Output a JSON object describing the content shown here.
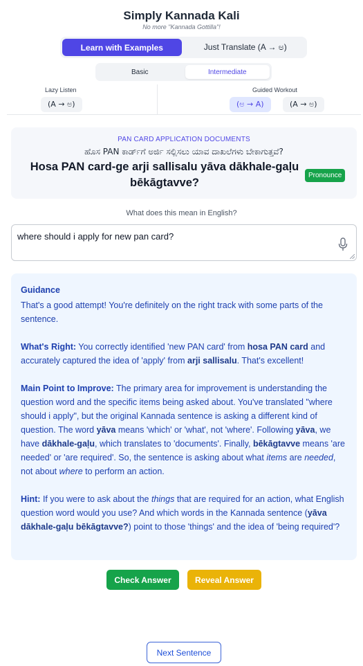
{
  "app": {
    "title": "Simply Kannada Kali",
    "tagline": "No more \"Kannada Gottilla\"!"
  },
  "modes": {
    "learn_label": "Learn with Examples",
    "translate_label": "Just Translate (A → ಅ)",
    "active": "learn"
  },
  "levels": {
    "basic_label": "Basic",
    "intermediate_label": "Intermediate",
    "active": "intermediate"
  },
  "practice": {
    "lazy_listen_label": "Lazy Listen",
    "lazy_listen_btn": "(A → ಅ)",
    "guided_workout_label": "Guided Workout",
    "guided_btn_1": "(ಅ → A)",
    "guided_btn_2": "(A → ಅ)"
  },
  "sentence": {
    "category": "PAN CARD APPLICATION DOCUMENTS",
    "kannada": "ಹೊಸ PAN ಕಾರ್ಡ್‌ಗೆ ಅರ್ಜಿ ಸಲ್ಲಿಸಲು ಯಾವ ದಾಖಲೆಗಳು ಬೇಕಾಗುತ್ತವೆ?",
    "transliteration": "Hosa PAN card-ge arji sallisalu yāva dākhale-gaḷu bēkāgtavve?",
    "pronounce_label": "Pronounce"
  },
  "prompt": {
    "question": "What does this mean in English?",
    "answer_value": "where should i apply for new pan card?"
  },
  "guidance": {
    "title": "Guidance",
    "intro": "That's a good attempt! You're definitely on the right track with some parts of the sentence.",
    "whats_right_label": "What's Right:",
    "right_1": " You correctly identified 'new PAN card' from ",
    "right_b1": "hosa PAN card",
    "right_2": " and accurately captured the idea of 'apply' from ",
    "right_b2": "arji sallisalu",
    "right_3": ". That's excellent!",
    "improve_label": "Main Point to Improve:",
    "imp_1": " The primary area for improvement is understanding the question word and the specific items being asked about. You've translated \"where should i apply\", but the original Kannada sentence is asking a different kind of question. The word ",
    "imp_b1": "yāva",
    "imp_2": " means 'which' or 'what', not 'where'. Following ",
    "imp_b2": "yāva",
    "imp_3": ", we have ",
    "imp_b3": "dākhale-gaḷu",
    "imp_4": ", which translates to 'documents'. Finally, ",
    "imp_b4": "bēkāgtavve",
    "imp_5": " means 'are needed' or 'are required'. So, the sentence is asking about what ",
    "imp_i1": "items",
    "imp_6": " are ",
    "imp_i2": "needed",
    "imp_7": ", not about ",
    "imp_i3": "where",
    "imp_8": " to perform an action.",
    "hint_label": "Hint:",
    "hint_1": " If you were to ask about the ",
    "hint_i1": "things",
    "hint_2": " that are required for an action, what English question word would you use? And which words in the Kannada sentence (",
    "hint_b1": "yāva dākhale-gaḷu bēkāgtavve?",
    "hint_3": ") point to those 'things' and the idea of 'being required'?"
  },
  "actions": {
    "check_label": "Check Answer",
    "reveal_label": "Reveal Answer",
    "next_label": "Next Sentence"
  },
  "colors": {
    "accent": "#4f46e5",
    "success": "#16a34a",
    "warning": "#eab308",
    "guidance_bg": "#eff6ff",
    "guidance_text": "#1e40af"
  },
  "icons": {
    "mic": "microphone-icon",
    "resize": "resize-grip-icon"
  }
}
